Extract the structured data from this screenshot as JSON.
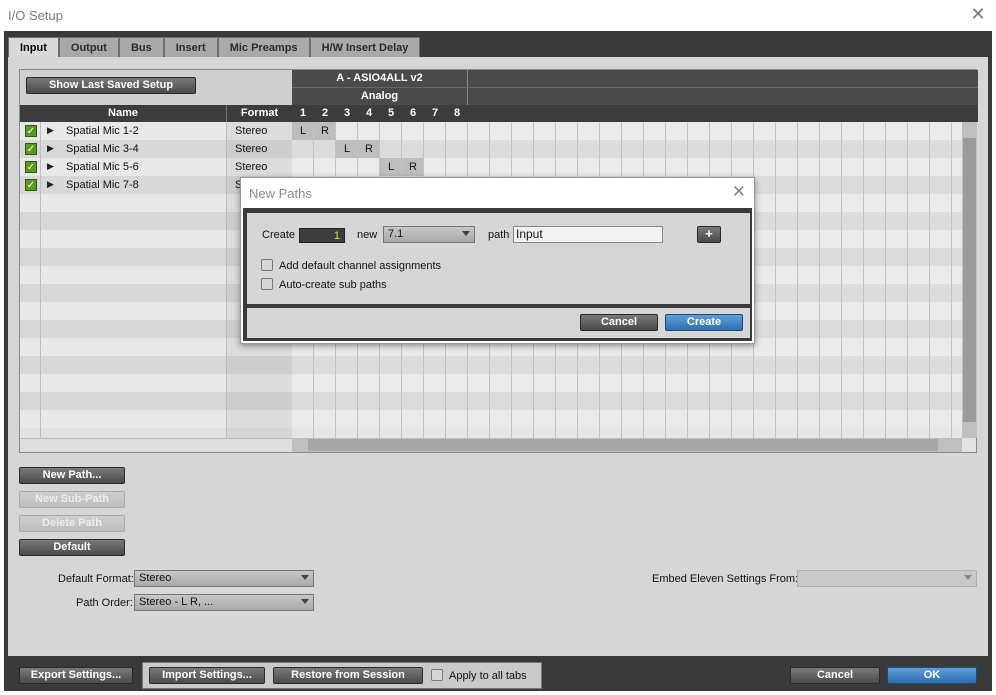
{
  "window": {
    "title": "I/O Setup"
  },
  "tabs": [
    "Input",
    "Output",
    "Bus",
    "Insert",
    "Mic Preamps",
    "H/W Insert Delay"
  ],
  "table": {
    "show_last_saved": "Show Last Saved Setup",
    "device": "A - ASIO4ALL v2",
    "group": "Analog",
    "col_name": "Name",
    "col_format": "Format",
    "channels": [
      "1",
      "2",
      "3",
      "4",
      "5",
      "6",
      "7",
      "8"
    ],
    "rows": [
      {
        "name": "Spatial Mic 1-2",
        "format": "Stereo",
        "checked": true,
        "cells": [
          {
            "ch": 0,
            "label": "L"
          },
          {
            "ch": 1,
            "label": "R"
          }
        ]
      },
      {
        "name": "Spatial Mic 3-4",
        "format": "Stereo",
        "checked": true,
        "cells": [
          {
            "ch": 2,
            "label": "L"
          },
          {
            "ch": 3,
            "label": "R"
          }
        ]
      },
      {
        "name": "Spatial Mic 5-6",
        "format": "Stereo",
        "checked": true,
        "cells": [
          {
            "ch": 4,
            "label": "L"
          },
          {
            "ch": 5,
            "label": "R"
          }
        ]
      },
      {
        "name": "Spatial Mic 7-8",
        "format": "S",
        "checked": true,
        "cells": []
      }
    ]
  },
  "actions": {
    "new_path": "New Path...",
    "new_sub_path": "New Sub-Path",
    "delete_path": "Delete Path",
    "default": "Default"
  },
  "settings": {
    "default_format_label": "Default Format:",
    "default_format_value": "Stereo",
    "path_order_label": "Path Order:",
    "path_order_value": "Stereo - L R, ...",
    "embed_label": "Embed Eleven Settings From:",
    "embed_value": ""
  },
  "footer": {
    "export": "Export Settings...",
    "import": "Import Settings...",
    "restore": "Restore from Session",
    "apply_all": "Apply to all tabs",
    "cancel": "Cancel",
    "ok": "OK"
  },
  "dialog": {
    "title": "New Paths",
    "create_label": "Create",
    "count": "1",
    "new_label": "new",
    "format_value": "7.1",
    "path_label": "path",
    "path_value": "Input",
    "plus": "+",
    "opt_default_assign": "Add default channel assignments",
    "opt_auto_sub": "Auto-create sub paths",
    "cancel": "Cancel",
    "create": "Create"
  }
}
